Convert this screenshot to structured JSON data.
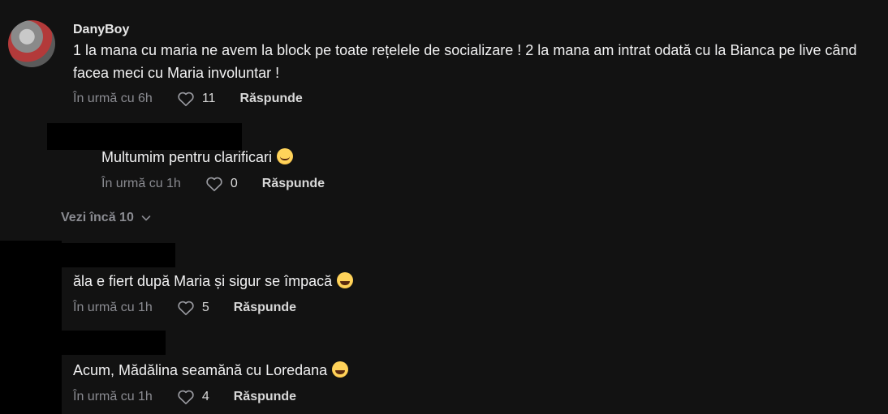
{
  "comment_main": {
    "username": "DanyBoy",
    "text": "1 la mana cu maria ne avem la block pe toate rețelele de socializare ! 2 la mana am intrat odată cu la Bianca pe live când facea meci cu Maria involuntar !",
    "time": "În urmă cu 6h",
    "likes": "11",
    "reply_label": "Răspunde"
  },
  "reply_1": {
    "text": "Multumim pentru clarificari",
    "emoji": "smiling-face-emoji",
    "time": "În urmă cu 1h",
    "likes": "0",
    "reply_label": "Răspunde"
  },
  "see_more": {
    "label": "Vezi încă 10"
  },
  "comment_2": {
    "text": "ăla e fiert după Maria și sigur se împacă",
    "emoji": "rolling-laughing-emoji",
    "time": "În urmă cu 1h",
    "likes": "5",
    "reply_label": "Răspunde"
  },
  "comment_3": {
    "text": "Acum, Mădălina seamănă cu Loredana",
    "emoji": "grinning-squinting-emoji",
    "time": "În urmă cu 1h",
    "likes": "4",
    "reply_label": "Răspunde"
  },
  "colors": {
    "background": "#121212",
    "text": "#f1f1f2",
    "muted": "#8a8b91"
  }
}
